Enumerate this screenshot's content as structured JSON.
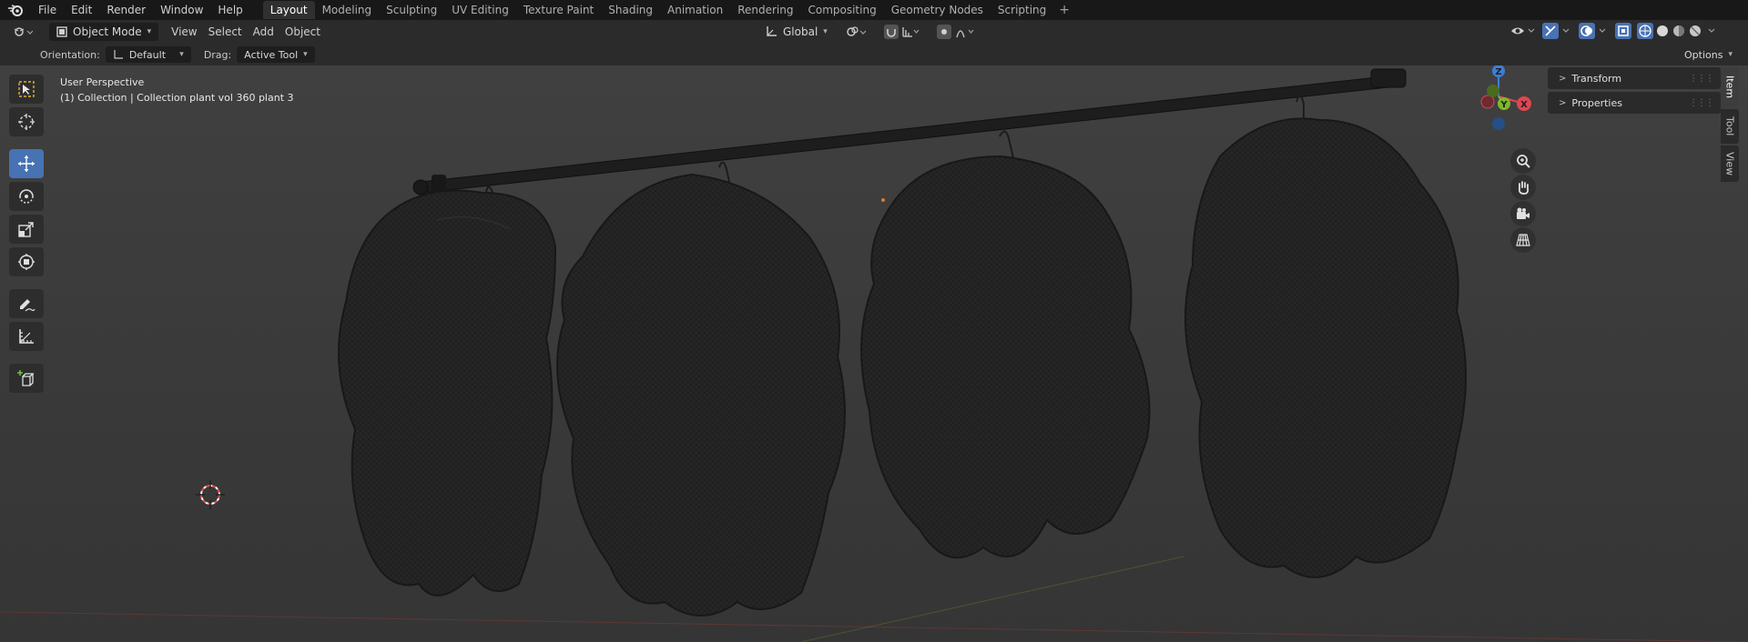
{
  "menubar": {
    "items": [
      "File",
      "Edit",
      "Render",
      "Window",
      "Help"
    ],
    "workspaces": [
      "Layout",
      "Modeling",
      "Sculpting",
      "UV Editing",
      "Texture Paint",
      "Shading",
      "Animation",
      "Rendering",
      "Compositing",
      "Geometry Nodes",
      "Scripting"
    ],
    "active_workspace": "Layout",
    "add_tab": "+"
  },
  "header": {
    "mode": "Object Mode",
    "menus": [
      "View",
      "Select",
      "Add",
      "Object"
    ],
    "transform_orientation": "Global"
  },
  "toolsettings": {
    "orientation_label": "Orientation:",
    "orientation_value": "Default",
    "drag_label": "Drag:",
    "drag_value": "Active Tool",
    "options_label": "Options"
  },
  "viewport": {
    "perspective": "User Perspective",
    "collection_info": "(1) Collection | Collection plant vol 360 plant 3"
  },
  "npanel": {
    "sections": [
      "Transform",
      "Properties"
    ],
    "tabs": [
      "Item",
      "Tool",
      "View"
    ],
    "active_tab": "Item"
  },
  "gizmo": {
    "axes": [
      "X",
      "Y",
      "Z"
    ],
    "colors": {
      "x": "#e04552",
      "y": "#80b82a",
      "z": "#3d7fd6"
    }
  },
  "colors": {
    "accent": "#4772b3",
    "background": "#3a3a3a",
    "topbar": "#181818"
  }
}
